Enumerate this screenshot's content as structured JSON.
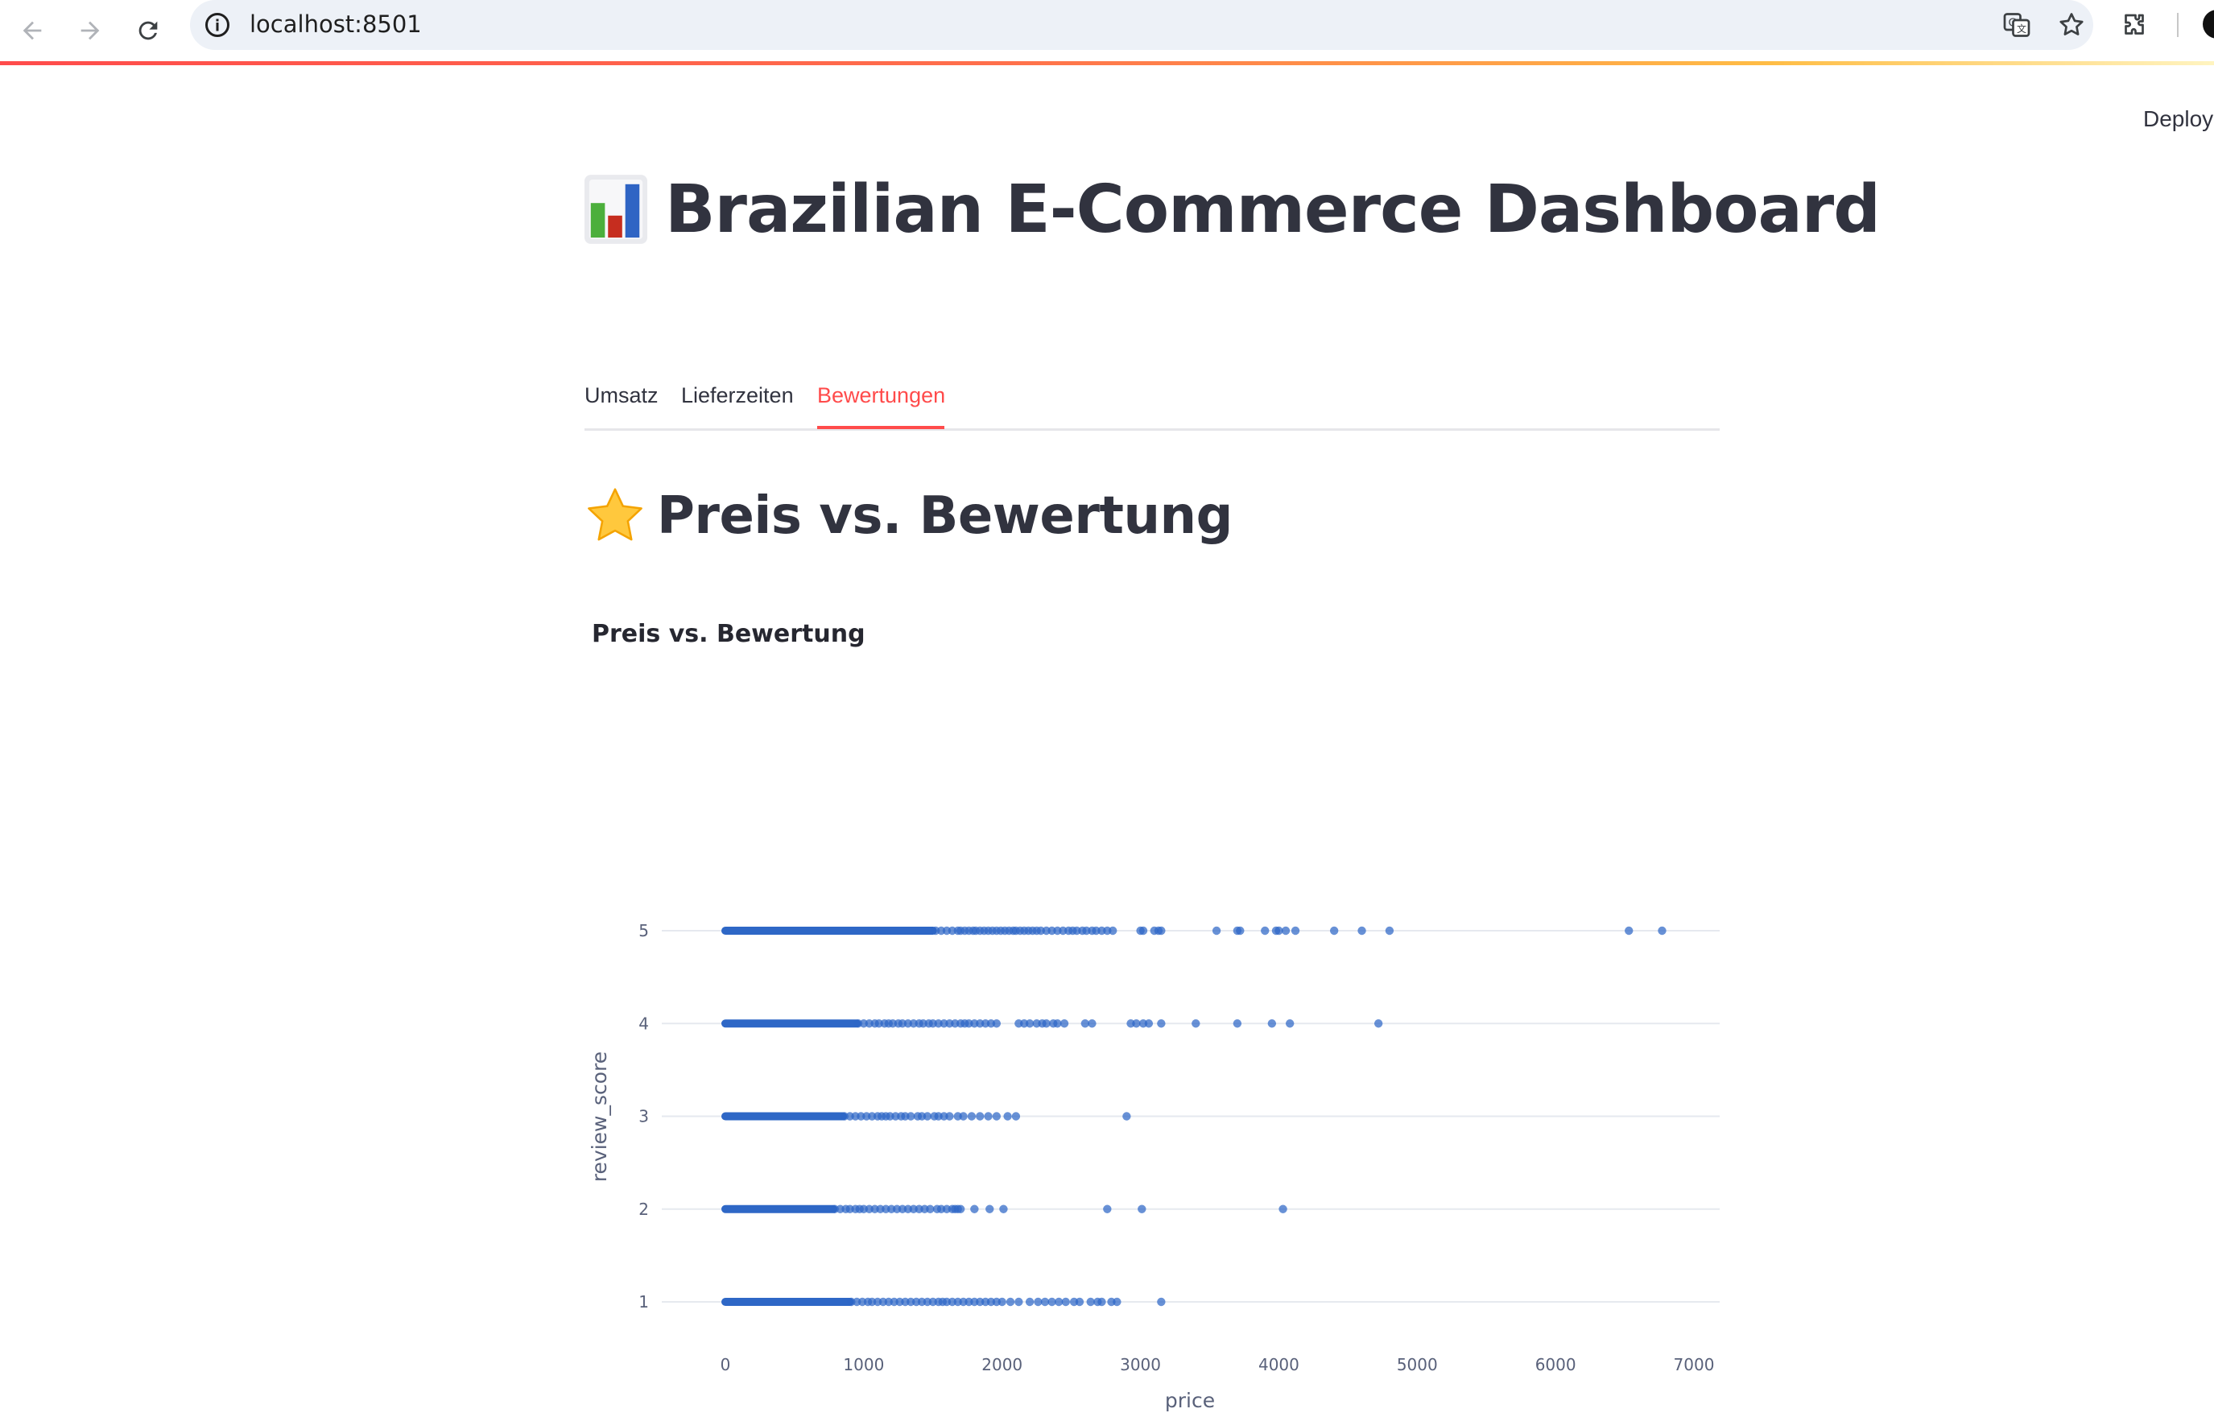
{
  "browser": {
    "url": "localhost:8501",
    "icons": [
      "back-arrow-icon",
      "forward-arrow-icon",
      "reload-icon",
      "site-info-icon",
      "translate-icon",
      "bookmark-star-icon",
      "extensions-puzzle-icon",
      "profile-avatar-icon"
    ]
  },
  "app": {
    "deploy_label": "Deploy",
    "title": "Brazilian E-Commerce Dashboard",
    "title_icon": "bar-chart-emoji-icon",
    "accent_color": "#ff4b4b"
  },
  "tabs": [
    {
      "label": "Umsatz",
      "active": false
    },
    {
      "label": "Lieferzeiten",
      "active": false
    },
    {
      "label": "Bewertungen",
      "active": true
    }
  ],
  "section": {
    "title": "Preis vs. Bewertung",
    "icon": "star-emoji-icon"
  },
  "chart_data": {
    "type": "scatter",
    "title": "Preis vs. Bewertung",
    "xlabel": "price",
    "ylabel": "review_score",
    "xlim": [
      -100,
      7200
    ],
    "ylim": [
      0.6,
      5.4
    ],
    "x_ticks": [
      0,
      1000,
      2000,
      3000,
      4000,
      5000,
      6000,
      7000
    ],
    "y_ticks": [
      1,
      2,
      3,
      4,
      5
    ],
    "grid": "horizontal",
    "marker_color": "#2e67c6",
    "dense_ranges": [
      {
        "y": 5,
        "from": 0,
        "to": 1500
      },
      {
        "y": 4,
        "from": 0,
        "to": 950
      },
      {
        "y": 3,
        "from": 0,
        "to": 850
      },
      {
        "y": 2,
        "from": 0,
        "to": 780
      },
      {
        "y": 1,
        "from": 0,
        "to": 900
      }
    ],
    "points": [
      {
        "y": 5,
        "x": [
          1520,
          1560,
          1600,
          1640,
          1680,
          1700,
          1730,
          1760,
          1790,
          1810,
          1840,
          1870,
          1900,
          1930,
          1960,
          1990,
          2020,
          2050,
          2080,
          2100,
          2130,
          2160,
          2190,
          2220,
          2250,
          2280,
          2320,
          2360,
          2400,
          2440,
          2480,
          2510,
          2540,
          2580,
          2610,
          2650,
          2680,
          2720,
          2760,
          2800,
          3000,
          3020,
          3100,
          3130,
          3150,
          3550,
          3700,
          3720,
          3900,
          3980,
          4000,
          4050,
          4120,
          4400,
          4600,
          4800,
          6530,
          6770
        ]
      },
      {
        "y": 4,
        "x": [
          960,
          1000,
          1040,
          1080,
          1110,
          1150,
          1180,
          1210,
          1250,
          1280,
          1320,
          1360,
          1400,
          1430,
          1470,
          1500,
          1540,
          1580,
          1620,
          1660,
          1700,
          1730,
          1760,
          1800,
          1840,
          1880,
          1920,
          1960,
          2120,
          2160,
          2200,
          2250,
          2290,
          2320,
          2370,
          2400,
          2450,
          2600,
          2650,
          2930,
          2970,
          3020,
          3060,
          3150,
          3400,
          3700,
          3950,
          4080,
          4720
        ]
      },
      {
        "y": 3,
        "x": [
          860,
          900,
          940,
          980,
          1020,
          1060,
          1100,
          1130,
          1160,
          1190,
          1230,
          1270,
          1300,
          1340,
          1390,
          1420,
          1460,
          1510,
          1540,
          1580,
          1620,
          1680,
          1720,
          1780,
          1840,
          1900,
          1960,
          2040,
          2100,
          2900
        ]
      },
      {
        "y": 2,
        "x": [
          790,
          830,
          870,
          900,
          940,
          970,
          1000,
          1040,
          1080,
          1120,
          1160,
          1200,
          1240,
          1280,
          1320,
          1360,
          1400,
          1440,
          1480,
          1530,
          1560,
          1600,
          1640,
          1660,
          1680,
          1700,
          1800,
          1910,
          2010,
          2760,
          3010,
          4030
        ]
      },
      {
        "y": 1,
        "x": [
          910,
          950,
          990,
          1030,
          1060,
          1100,
          1140,
          1180,
          1220,
          1260,
          1300,
          1340,
          1380,
          1420,
          1460,
          1500,
          1540,
          1570,
          1600,
          1640,
          1680,
          1720,
          1760,
          1800,
          1840,
          1880,
          1920,
          1960,
          2000,
          2060,
          2120,
          2200,
          2260,
          2310,
          2360,
          2410,
          2460,
          2520,
          2560,
          2640,
          2690,
          2720,
          2790,
          2830,
          3150
        ]
      }
    ]
  }
}
